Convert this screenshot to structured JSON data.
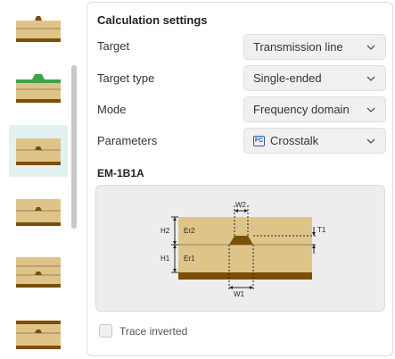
{
  "thumbnails": [
    {
      "name": "stackup-variant-1",
      "selected": false
    },
    {
      "name": "stackup-variant-2",
      "selected": false
    },
    {
      "name": "stackup-variant-3",
      "selected": true
    },
    {
      "name": "stackup-variant-4",
      "selected": false
    },
    {
      "name": "stackup-variant-5",
      "selected": false
    },
    {
      "name": "stackup-variant-6",
      "selected": false
    }
  ],
  "panel": {
    "title": "Calculation settings",
    "rows": {
      "target": {
        "label": "Target",
        "value": "Transmission line"
      },
      "target_type": {
        "label": "Target type",
        "value": "Single-ended"
      },
      "mode": {
        "label": "Mode",
        "value": "Frequency domain"
      },
      "parameters": {
        "label": "Parameters",
        "icon_text": "FC",
        "value": "Crosstalk"
      }
    },
    "model_title": "EM-1B1A",
    "diagram": {
      "labels": {
        "w2": "W2",
        "w1": "W1",
        "h2": "H2",
        "h1": "H1",
        "er2": "Er2",
        "er1": "Er1",
        "t1": "T1"
      }
    },
    "trace_inverted": {
      "label": "Trace inverted",
      "checked": false
    }
  },
  "colors": {
    "dielectric": "#dfc48a",
    "copper": "#7a4f06",
    "mask": "#3fa34d",
    "selected_bg": "#e3f1f1"
  }
}
